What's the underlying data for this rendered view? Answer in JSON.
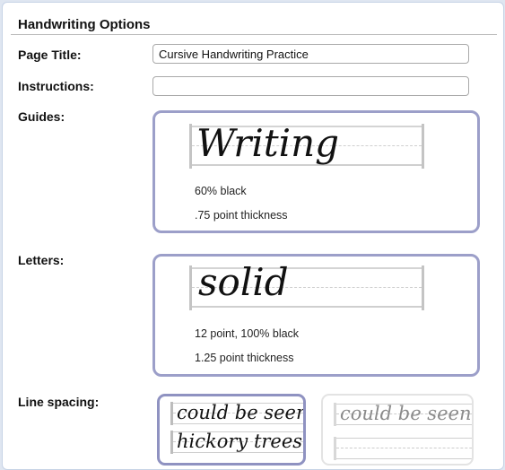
{
  "panel": {
    "title": "Handwriting Options"
  },
  "page_title": {
    "label": "Page Title:",
    "value": "Cursive Handwriting Practice"
  },
  "instructions": {
    "label": "Instructions:",
    "value": ""
  },
  "guides": {
    "label": "Guides:",
    "sample_word": "Writing",
    "color": "60% black",
    "thickness": ".75 point thickness"
  },
  "letters": {
    "label": "Letters:",
    "sample_word": "solid",
    "size_color": "12 point, 100% black",
    "thickness": "1.25 point thickness"
  },
  "line_spacing": {
    "label": "Line spacing:",
    "options": [
      {
        "line1": "could be seen",
        "line2": "hickory trees",
        "selected": true
      },
      {
        "line1": "could be seen",
        "line2": "",
        "selected": false
      }
    ]
  },
  "colors": {
    "selected_border": "#9c9fc9",
    "guide_line": "#cfcfcf"
  }
}
